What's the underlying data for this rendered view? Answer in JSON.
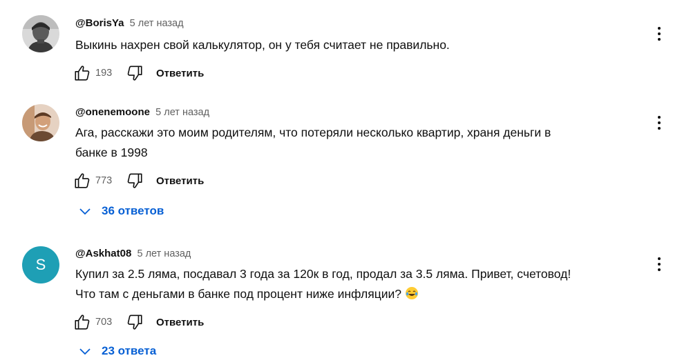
{
  "comments": [
    {
      "author": "@BorisYa",
      "time": "5 лет назад",
      "text_lines": [
        "Выкинь нахрен свой калькулятор, он у тебя считает не правильно."
      ],
      "likes": "193",
      "reply_label": "Ответить",
      "avatar": "photo"
    },
    {
      "author": "@onenemoone",
      "time": "5 лет назад",
      "text_lines": [
        "Ага, расскажи это моим родителям, что потеряли несколько квартир, храня деньги в",
        "банке в 1998"
      ],
      "likes": "773",
      "reply_label": "Ответить",
      "avatar": "photo",
      "replies_label": "36 ответов"
    },
    {
      "author": "@Askhat08",
      "time": "5 лет назад",
      "text_lines": [
        "Купил за 2.5 ляма, посдавал 3 года за 120к в год, продал за 3.5 ляма. Привет, счетовод!",
        "Что там с деньгами в банке под процент ниже инфляции?"
      ],
      "emoji": "laughing-emoji",
      "likes": "703",
      "reply_label": "Ответить",
      "avatar_letter": "S",
      "avatar_color": "#1e9fb5",
      "replies_label": "23 ответа"
    }
  ],
  "icons": {
    "like": "thumbs-up-icon",
    "dislike": "thumbs-down-icon",
    "menu": "more-vert-icon",
    "expand": "chevron-down-icon"
  },
  "colors": {
    "link_blue": "#065fd4",
    "muted": "#606060",
    "text": "#0f0f0f"
  }
}
